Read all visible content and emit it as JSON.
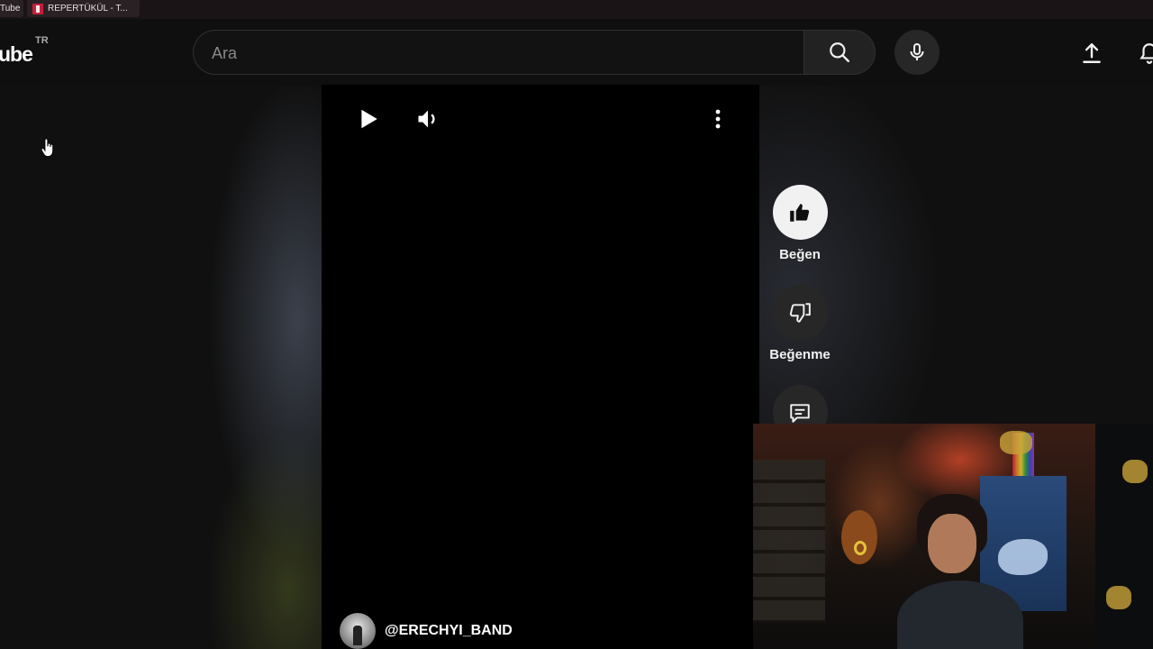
{
  "tabs": [
    {
      "label": "Tube"
    },
    {
      "label": "REPERTÜKÜL - T..."
    }
  ],
  "masthead": {
    "logo_text": "ube",
    "country_code": "TR",
    "search_placeholder": "Ara"
  },
  "player": {
    "channel_handle": "@ERECHYI_BAND"
  },
  "actions": {
    "like_label": "Beğen",
    "dislike_label": "Beğenme"
  },
  "colors": {
    "background": "#0f0f0f",
    "player": "#000000",
    "like_button": "#f1f1f1",
    "secondary_button": "#272727"
  },
  "icons": {
    "search": "search-icon",
    "mic": "mic-icon",
    "upload": "upload-icon",
    "bell": "bell-icon",
    "play": "play-icon",
    "volume": "volume-icon",
    "more": "more-vert-icon",
    "like": "thumbs-up-icon",
    "dislike": "thumbs-down-icon",
    "comment": "comment-icon"
  }
}
